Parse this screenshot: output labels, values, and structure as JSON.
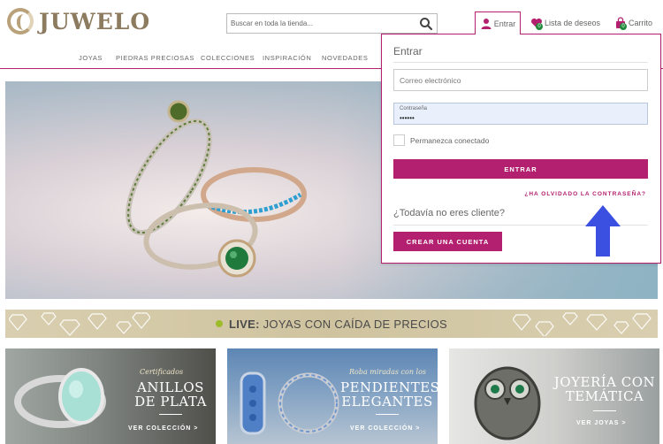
{
  "brand": {
    "name": "JUWELO"
  },
  "search": {
    "placeholder": "Buscar en toda la tienda..."
  },
  "header": {
    "login_label": "Entrar",
    "wishlist_label": "Lista de deseos",
    "wishlist_count": "0",
    "cart_label": "Carrito",
    "cart_count": "0"
  },
  "nav": {
    "items": [
      "JOYAS",
      "PIEDRAS PRECIOSAS",
      "COLECCIONES",
      "INSPIRACIÓN",
      "NOVEDADES"
    ]
  },
  "live_banner": {
    "prefix": "LIVE:",
    "text": " JOYAS CON CAÍDA DE PRECIOS"
  },
  "tiles": [
    {
      "script": "Certificados",
      "title_line1": "ANILLOS",
      "title_line2": "DE PLATA",
      "cta": "VER COLECCIÓN >"
    },
    {
      "script": "Roba miradas con los",
      "title_line1": "PENDIENTES",
      "title_line2": "ELEGANTES",
      "cta": "VER COLECCIÓN >"
    },
    {
      "script": "",
      "title_line1": "JOYERÍA CON",
      "title_line2": "TEMÁTICA",
      "cta": "VER JOYAS >"
    }
  ],
  "login": {
    "title": "Entrar",
    "email_placeholder": "Correo electrónico",
    "password_label": "Contraseña",
    "password_value": "••••••",
    "remember_label": "Permanezca conectado",
    "submit_label": "ENTRAR",
    "forgot_label": "¿HA OLVIDADO LA CONTRASEÑA?",
    "new_customer_label": "¿Todavía no eres cliente?",
    "create_account_label": "CREAR UNA CUENTA"
  },
  "colors": {
    "accent": "#b3206f",
    "badge": "#1f8a3b",
    "live_dot": "#9dbb2b",
    "annotation_arrow": "#3b4fe0"
  }
}
